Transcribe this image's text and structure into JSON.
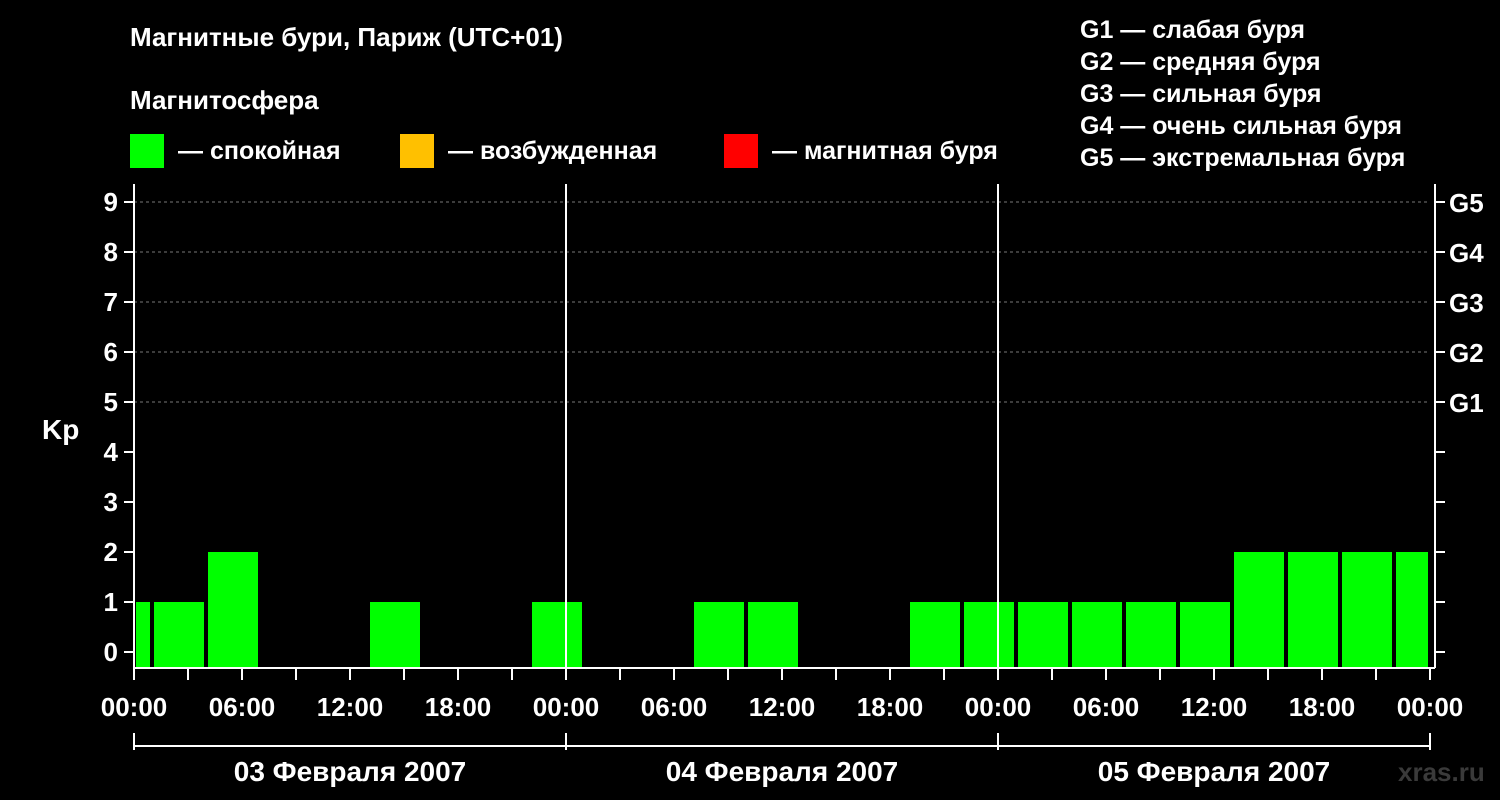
{
  "header": {
    "title": "Магнитные бури, Париж (UTC+01)",
    "subtitle": "Магнитосфера"
  },
  "legend": [
    {
      "label": "— спокойная",
      "color": "#00ff00"
    },
    {
      "label": "— возбужденная",
      "color": "#ffc000"
    },
    {
      "label": "— магнитная буря",
      "color": "#ff0000"
    }
  ],
  "storm_levels": [
    "G1 — слабая буря",
    "G2 — средняя буря",
    "G3 — сильная буря",
    "G4 — очень сильная буря",
    "G5 — экстремальная буря"
  ],
  "watermark": "xras.ru",
  "chart_data": {
    "type": "bar",
    "ylabel": "Kp",
    "xlabel": "",
    "ylim": [
      0,
      9
    ],
    "yticks": [
      "0",
      "1",
      "2",
      "3",
      "4",
      "5",
      "6",
      "7",
      "8",
      "9"
    ],
    "right_axis": [
      {
        "value": 5,
        "label": "G1"
      },
      {
        "value": 6,
        "label": "G2"
      },
      {
        "value": 7,
        "label": "G3"
      },
      {
        "value": 8,
        "label": "G4"
      },
      {
        "value": 9,
        "label": "G5"
      }
    ],
    "x_hours_range": [
      0,
      72
    ],
    "xticks": [
      {
        "hour": 0,
        "label": "00:00"
      },
      {
        "hour": 6,
        "label": "06:00"
      },
      {
        "hour": 12,
        "label": "12:00"
      },
      {
        "hour": 18,
        "label": "18:00"
      },
      {
        "hour": 24,
        "label": "00:00"
      },
      {
        "hour": 30,
        "label": "06:00"
      },
      {
        "hour": 36,
        "label": "12:00"
      },
      {
        "hour": 42,
        "label": "18:00"
      },
      {
        "hour": 48,
        "label": "00:00"
      },
      {
        "hour": 54,
        "label": "06:00"
      },
      {
        "hour": 60,
        "label": "12:00"
      },
      {
        "hour": 66,
        "label": "18:00"
      },
      {
        "hour": 72,
        "label": "00:00"
      }
    ],
    "days": [
      {
        "label": "03 Февраля 2007",
        "start_hour": 0,
        "end_hour": 24
      },
      {
        "label": "04 Февраля 2007",
        "start_hour": 24,
        "end_hour": 48
      },
      {
        "label": "05 Февраля 2007",
        "start_hour": 48,
        "end_hour": 72
      }
    ],
    "gridlines": [
      5,
      6,
      7,
      8,
      9
    ],
    "bar_color": "#00ff00",
    "bars": [
      {
        "start_hour": 0,
        "end_hour": 1,
        "kp": 1
      },
      {
        "start_hour": 1,
        "end_hour": 4,
        "kp": 1
      },
      {
        "start_hour": 4,
        "end_hour": 7,
        "kp": 2
      },
      {
        "start_hour": 7,
        "end_hour": 10,
        "kp": 0
      },
      {
        "start_hour": 10,
        "end_hour": 13,
        "kp": 0
      },
      {
        "start_hour": 13,
        "end_hour": 16,
        "kp": 1
      },
      {
        "start_hour": 16,
        "end_hour": 19,
        "kp": 0
      },
      {
        "start_hour": 19,
        "end_hour": 22,
        "kp": 0
      },
      {
        "start_hour": 22,
        "end_hour": 25,
        "kp": 1
      },
      {
        "start_hour": 25,
        "end_hour": 28,
        "kp": 0
      },
      {
        "start_hour": 28,
        "end_hour": 31,
        "kp": 0
      },
      {
        "start_hour": 31,
        "end_hour": 34,
        "kp": 1
      },
      {
        "start_hour": 34,
        "end_hour": 37,
        "kp": 1
      },
      {
        "start_hour": 37,
        "end_hour": 40,
        "kp": 0
      },
      {
        "start_hour": 40,
        "end_hour": 43,
        "kp": 0
      },
      {
        "start_hour": 43,
        "end_hour": 46,
        "kp": 1
      },
      {
        "start_hour": 46,
        "end_hour": 49,
        "kp": 1
      },
      {
        "start_hour": 49,
        "end_hour": 52,
        "kp": 1
      },
      {
        "start_hour": 52,
        "end_hour": 55,
        "kp": 1
      },
      {
        "start_hour": 55,
        "end_hour": 58,
        "kp": 1
      },
      {
        "start_hour": 58,
        "end_hour": 61,
        "kp": 1
      },
      {
        "start_hour": 61,
        "end_hour": 64,
        "kp": 2
      },
      {
        "start_hour": 64,
        "end_hour": 67,
        "kp": 2
      },
      {
        "start_hour": 67,
        "end_hour": 70,
        "kp": 2
      },
      {
        "start_hour": 70,
        "end_hour": 72,
        "kp": 2
      }
    ]
  }
}
